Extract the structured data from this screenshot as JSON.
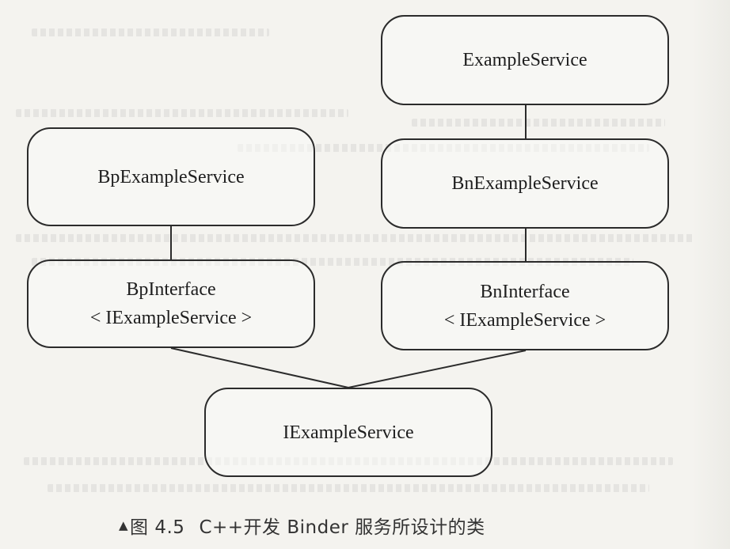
{
  "diagram": {
    "nodes": [
      {
        "id": "example-service",
        "lines": [
          "ExampleService"
        ]
      },
      {
        "id": "bp-example-service",
        "lines": [
          "BpExampleService"
        ]
      },
      {
        "id": "bn-example-service",
        "lines": [
          "BnExampleService"
        ]
      },
      {
        "id": "bp-interface",
        "lines": [
          "BpInterface",
          "< IExampleService >"
        ]
      },
      {
        "id": "bn-interface",
        "lines": [
          "BnInterface",
          "< IExampleService >"
        ]
      },
      {
        "id": "iexample-service",
        "lines": [
          "IExampleService"
        ]
      }
    ],
    "edges": [
      {
        "from": "example-service",
        "to": "bn-example-service"
      },
      {
        "from": "bp-example-service",
        "to": "bp-interface"
      },
      {
        "from": "bn-example-service",
        "to": "bn-interface"
      },
      {
        "from": "bp-interface",
        "to": "iexample-service"
      },
      {
        "from": "bn-interface",
        "to": "iexample-service"
      }
    ]
  },
  "caption": {
    "marker": "▲",
    "figure_label": "图 4.5",
    "text": "C++开发 Binder 服务所设计的类"
  },
  "colors": {
    "paper": "#f4f3ef",
    "stroke": "#2b2b2b",
    "text": "#1e1e1e"
  }
}
